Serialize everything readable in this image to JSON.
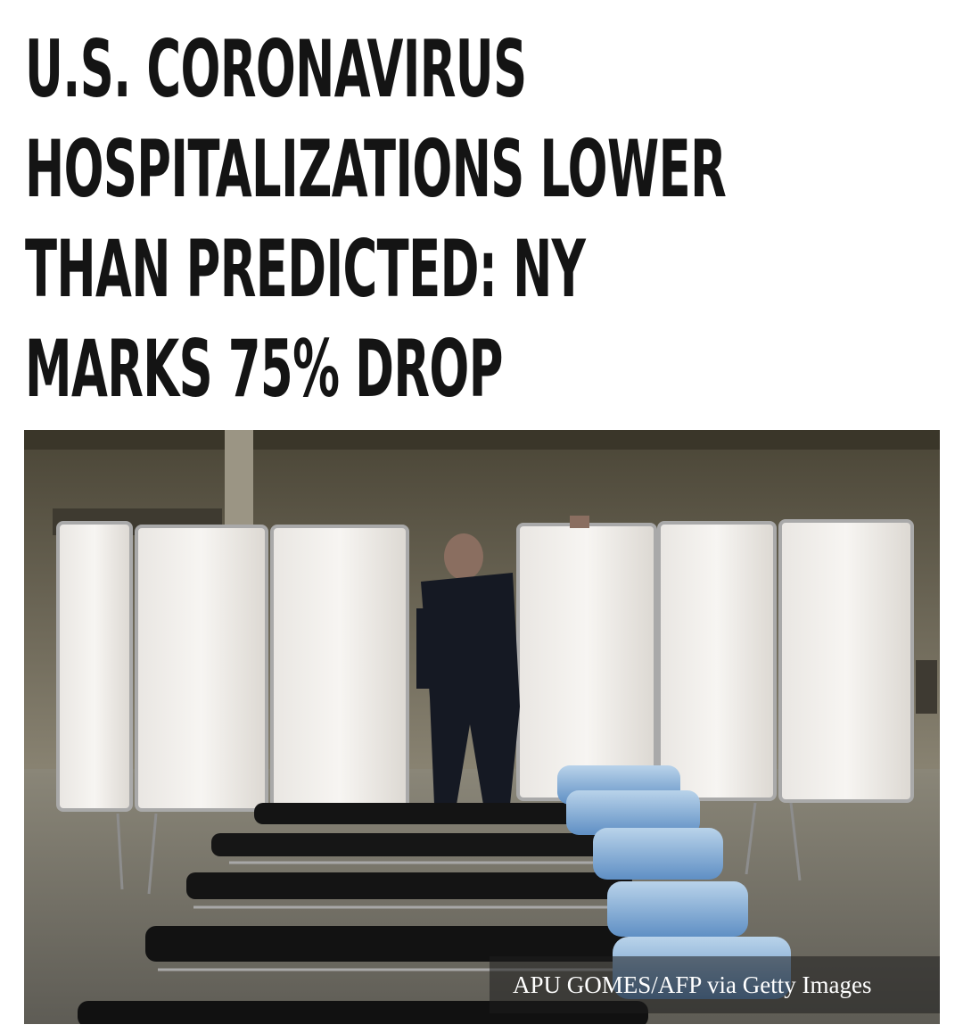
{
  "headline": {
    "lines": [
      "U.S. CORONAVIRUS",
      "HOSPITALIZATIONS LOWER",
      "THAN PREDICTED: NY",
      "MARKS 75% DROP"
    ]
  },
  "photo": {
    "credit": "APU GOMES/AFP via Getty Images"
  },
  "colors": {
    "headline_text": "#141414",
    "background": "#ffffff"
  }
}
